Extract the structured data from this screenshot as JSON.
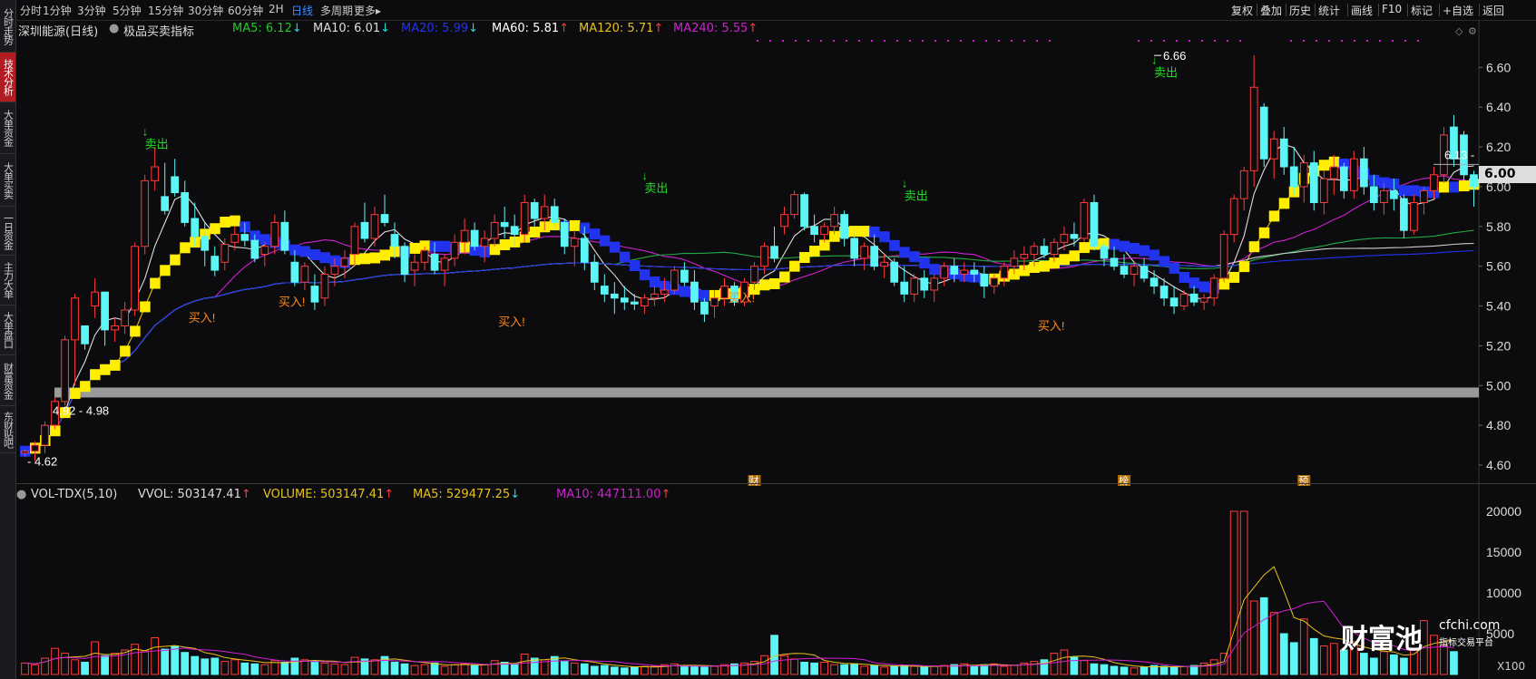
{
  "sidebar": {
    "items": [
      {
        "label": "分时走势",
        "active": false
      },
      {
        "label": "技术分析",
        "active": true
      },
      {
        "label": "大单资金",
        "active": false
      },
      {
        "label": "大单买卖",
        "active": false
      },
      {
        "label": "一日资金",
        "active": false
      },
      {
        "label": "主力大单",
        "active": false
      },
      {
        "label": "大单盘口",
        "active": false
      },
      {
        "label": "财富资金",
        "active": false
      },
      {
        "label": "东财贴吧",
        "active": false
      }
    ]
  },
  "toolbar": {
    "timeframes": [
      "分时",
      "1分钟",
      "3分钟",
      "5分钟",
      "15分钟",
      "30分钟",
      "60分钟",
      "2H",
      "日线",
      "多周期",
      "更多"
    ],
    "active_timeframe": "日线",
    "more_arrow": "▸",
    "right_buttons": [
      "复权",
      "叠加",
      "历史",
      "统计",
      "画线",
      "F10",
      "标记",
      "+自选",
      "返回"
    ]
  },
  "chart_header": {
    "title": "深圳能源(日线)",
    "indicator": "极品买卖指标",
    "ma": [
      {
        "label": "MA5: 6.12",
        "arrow": "↓",
        "color": "#22cc22"
      },
      {
        "label": "MA10: 6.01",
        "arrow": "↓",
        "color": "#dddddd"
      },
      {
        "label": "MA20: 5.99",
        "arrow": "↓",
        "color": "#2233ee"
      },
      {
        "label": "MA60: 5.81",
        "arrow": "↑",
        "color": "#ffffff"
      },
      {
        "label": "MA120: 5.71",
        "arrow": "↑",
        "color": "#e8c21b"
      },
      {
        "label": "MA240: 5.55",
        "arrow": "↑",
        "color": "#d020d0"
      }
    ],
    "arrow_up_color": "#ff3b3b",
    "arrow_down_color": "#22dddd"
  },
  "volume_header": {
    "name": "VOL-TDX(5,10)",
    "items": [
      {
        "label": "VVOL: 503147.41",
        "arrow": "↑",
        "color": "#dddddd"
      },
      {
        "label": "VOLUME: 503147.41",
        "arrow": "↑",
        "color": "#e8c21b"
      },
      {
        "label": "MA5: 529477.25",
        "arrow": "↓",
        "color": "#e8c21b"
      },
      {
        "label": "MA10: 447111.00",
        "arrow": "↑",
        "color": "#d020d0"
      }
    ]
  },
  "chart_data": [
    {
      "type": "candlestick",
      "name": "price",
      "ylim": [
        4.55,
        6.72
      ],
      "y_ticks": [
        "6.60",
        "6.40",
        "6.20",
        "6.00",
        "5.80",
        "5.60",
        "5.40",
        "5.20",
        "5.00",
        "4.80",
        "4.60"
      ],
      "current_price": "6.00",
      "ohlc": [
        [
          4.66,
          4.68,
          4.64,
          4.67
        ],
        [
          4.67,
          4.72,
          4.62,
          4.7
        ],
        [
          4.7,
          4.82,
          4.66,
          4.8
        ],
        [
          4.8,
          4.94,
          4.78,
          4.92
        ],
        [
          4.92,
          5.25,
          4.9,
          5.23
        ],
        [
          5.23,
          5.46,
          5.0,
          5.44
        ],
        [
          5.3,
          5.3,
          5.18,
          5.21
        ],
        [
          5.4,
          5.54,
          5.34,
          5.47
        ],
        [
          5.47,
          5.4,
          5.2,
          5.28
        ],
        [
          5.28,
          5.34,
          5.22,
          5.3
        ],
        [
          5.3,
          5.42,
          5.26,
          5.38
        ],
        [
          5.38,
          5.72,
          5.35,
          5.7
        ],
        [
          5.7,
          6.06,
          5.66,
          6.03
        ],
        [
          6.03,
          6.2,
          5.98,
          6.1
        ],
        [
          5.95,
          6.12,
          5.86,
          5.88
        ],
        [
          6.05,
          6.14,
          5.95,
          5.97
        ],
        [
          5.97,
          6.03,
          5.8,
          5.82
        ],
        [
          5.84,
          5.92,
          5.7,
          5.75
        ],
        [
          5.75,
          5.82,
          5.6,
          5.68
        ],
        [
          5.65,
          5.7,
          5.55,
          5.58
        ],
        [
          5.62,
          5.74,
          5.58,
          5.71
        ],
        [
          5.72,
          5.8,
          5.68,
          5.76
        ],
        [
          5.76,
          5.82,
          5.7,
          5.73
        ],
        [
          5.73,
          5.76,
          5.62,
          5.64
        ],
        [
          5.66,
          5.72,
          5.6,
          5.7
        ],
        [
          5.7,
          5.86,
          5.66,
          5.82
        ],
        [
          5.82,
          5.88,
          5.66,
          5.68
        ],
        [
          5.62,
          5.68,
          5.5,
          5.52
        ],
        [
          5.52,
          5.62,
          5.48,
          5.6
        ],
        [
          5.5,
          5.56,
          5.38,
          5.42
        ],
        [
          5.44,
          5.6,
          5.4,
          5.56
        ],
        [
          5.56,
          5.64,
          5.5,
          5.6
        ],
        [
          5.6,
          5.68,
          5.54,
          5.64
        ],
        [
          5.66,
          5.82,
          5.6,
          5.8
        ],
        [
          5.82,
          5.92,
          5.72,
          5.74
        ],
        [
          5.74,
          5.9,
          5.7,
          5.86
        ],
        [
          5.86,
          5.96,
          5.8,
          5.82
        ],
        [
          5.76,
          5.82,
          5.64,
          5.7
        ],
        [
          5.7,
          5.72,
          5.52,
          5.56
        ],
        [
          5.58,
          5.66,
          5.5,
          5.62
        ],
        [
          5.62,
          5.7,
          5.58,
          5.68
        ],
        [
          5.66,
          5.72,
          5.56,
          5.58
        ],
        [
          5.58,
          5.66,
          5.5,
          5.64
        ],
        [
          5.64,
          5.76,
          5.6,
          5.72
        ],
        [
          5.72,
          5.84,
          5.66,
          5.78
        ],
        [
          5.78,
          5.82,
          5.68,
          5.7
        ],
        [
          5.7,
          5.78,
          5.62,
          5.74
        ],
        [
          5.74,
          5.86,
          5.7,
          5.82
        ],
        [
          5.82,
          5.9,
          5.74,
          5.8
        ],
        [
          5.8,
          5.86,
          5.7,
          5.76
        ],
        [
          5.76,
          5.96,
          5.72,
          5.92
        ],
        [
          5.92,
          5.94,
          5.8,
          5.84
        ],
        [
          5.84,
          5.96,
          5.78,
          5.9
        ],
        [
          5.9,
          5.94,
          5.78,
          5.82
        ],
        [
          5.82,
          5.84,
          5.66,
          5.7
        ],
        [
          5.7,
          5.78,
          5.6,
          5.74
        ],
        [
          5.74,
          5.8,
          5.58,
          5.62
        ],
        [
          5.62,
          5.66,
          5.48,
          5.52
        ],
        [
          5.5,
          5.56,
          5.42,
          5.46
        ],
        [
          5.46,
          5.52,
          5.36,
          5.44
        ],
        [
          5.44,
          5.5,
          5.38,
          5.42
        ],
        [
          5.42,
          5.46,
          5.38,
          5.41
        ],
        [
          5.4,
          5.46,
          5.36,
          5.44
        ],
        [
          5.44,
          5.5,
          5.4,
          5.46
        ],
        [
          5.46,
          5.54,
          5.42,
          5.48
        ],
        [
          5.48,
          5.6,
          5.46,
          5.58
        ],
        [
          5.58,
          5.62,
          5.5,
          5.52
        ],
        [
          5.52,
          5.58,
          5.38,
          5.42
        ],
        [
          5.42,
          5.44,
          5.32,
          5.36
        ],
        [
          5.4,
          5.48,
          5.34,
          5.44
        ],
        [
          5.44,
          5.54,
          5.4,
          5.5
        ],
        [
          5.5,
          5.52,
          5.4,
          5.42
        ],
        [
          5.42,
          5.54,
          5.4,
          5.52
        ],
        [
          5.52,
          5.62,
          5.48,
          5.6
        ],
        [
          5.6,
          5.72,
          5.56,
          5.7
        ],
        [
          5.7,
          5.8,
          5.62,
          5.64
        ],
        [
          5.8,
          5.9,
          5.76,
          5.86
        ],
        [
          5.86,
          5.98,
          5.84,
          5.96
        ],
        [
          5.96,
          5.97,
          5.78,
          5.8
        ],
        [
          5.8,
          5.86,
          5.72,
          5.76
        ],
        [
          5.76,
          5.82,
          5.72,
          5.8
        ],
        [
          5.8,
          5.9,
          5.76,
          5.86
        ],
        [
          5.86,
          5.88,
          5.7,
          5.74
        ],
        [
          5.74,
          5.78,
          5.6,
          5.64
        ],
        [
          5.64,
          5.72,
          5.58,
          5.7
        ],
        [
          5.7,
          5.76,
          5.58,
          5.6
        ],
        [
          5.6,
          5.66,
          5.54,
          5.62
        ],
        [
          5.62,
          5.64,
          5.5,
          5.52
        ],
        [
          5.52,
          5.6,
          5.42,
          5.46
        ],
        [
          5.46,
          5.56,
          5.42,
          5.54
        ],
        [
          5.54,
          5.58,
          5.44,
          5.48
        ],
        [
          5.48,
          5.56,
          5.42,
          5.54
        ],
        [
          5.54,
          5.62,
          5.5,
          5.6
        ],
        [
          5.6,
          5.64,
          5.52,
          5.56
        ],
        [
          5.56,
          5.62,
          5.52,
          5.58
        ],
        [
          5.58,
          5.62,
          5.52,
          5.56
        ],
        [
          5.56,
          5.6,
          5.44,
          5.5
        ],
        [
          5.5,
          5.56,
          5.46,
          5.54
        ],
        [
          5.54,
          5.62,
          5.5,
          5.6
        ],
        [
          5.6,
          5.68,
          5.56,
          5.64
        ],
        [
          5.64,
          5.7,
          5.58,
          5.66
        ],
        [
          5.66,
          5.72,
          5.6,
          5.7
        ],
        [
          5.7,
          5.74,
          5.64,
          5.66
        ],
        [
          5.66,
          5.74,
          5.62,
          5.72
        ],
        [
          5.72,
          5.8,
          5.68,
          5.76
        ],
        [
          5.76,
          5.82,
          5.7,
          5.74
        ],
        [
          5.74,
          5.94,
          5.72,
          5.92
        ],
        [
          5.92,
          5.96,
          5.68,
          5.7
        ],
        [
          5.7,
          5.72,
          5.6,
          5.64
        ],
        [
          5.64,
          5.7,
          5.58,
          5.6
        ],
        [
          5.6,
          5.66,
          5.54,
          5.56
        ],
        [
          5.56,
          5.62,
          5.5,
          5.6
        ],
        [
          5.6,
          5.64,
          5.52,
          5.54
        ],
        [
          5.54,
          5.58,
          5.46,
          5.5
        ],
        [
          5.5,
          5.54,
          5.4,
          5.44
        ],
        [
          5.44,
          5.5,
          5.36,
          5.4
        ],
        [
          5.4,
          5.48,
          5.38,
          5.46
        ],
        [
          5.46,
          5.5,
          5.4,
          5.42
        ],
        [
          5.42,
          5.46,
          5.38,
          5.44
        ],
        [
          5.44,
          5.56,
          5.4,
          5.54
        ],
        [
          5.54,
          5.78,
          5.52,
          5.76
        ],
        [
          5.76,
          5.96,
          5.72,
          5.94
        ],
        [
          5.94,
          6.1,
          5.88,
          6.08
        ],
        [
          6.08,
          6.66,
          6.0,
          6.5
        ],
        [
          6.4,
          6.42,
          6.1,
          6.14
        ],
        [
          6.14,
          6.28,
          6.04,
          6.24
        ],
        [
          6.24,
          6.3,
          6.06,
          6.1
        ],
        [
          6.1,
          6.2,
          5.96,
          6.0
        ],
        [
          6.0,
          6.16,
          5.92,
          6.12
        ],
        [
          6.12,
          6.18,
          5.88,
          5.92
        ],
        [
          5.92,
          6.08,
          5.86,
          6.04
        ],
        [
          6.04,
          6.16,
          5.96,
          6.1
        ],
        [
          6.1,
          6.12,
          5.94,
          5.98
        ],
        [
          5.98,
          6.18,
          5.94,
          6.14
        ],
        [
          6.14,
          6.2,
          5.96,
          6.0
        ],
        [
          6.0,
          6.06,
          5.88,
          5.92
        ],
        [
          5.92,
          6.02,
          5.86,
          5.98
        ],
        [
          5.98,
          6.04,
          5.88,
          5.94
        ],
        [
          5.94,
          5.96,
          5.74,
          5.78
        ],
        [
          5.78,
          5.96,
          5.76,
          5.92
        ],
        [
          5.92,
          6.0,
          5.86,
          5.98
        ],
        [
          5.98,
          6.1,
          5.94,
          6.06
        ],
        [
          6.06,
          6.3,
          6.02,
          6.26
        ],
        [
          6.3,
          6.36,
          6.1,
          6.14
        ],
        [
          6.26,
          6.28,
          6.02,
          6.06
        ],
        [
          6.06,
          6.08,
          5.9,
          6.0
        ]
      ],
      "ma_series": [
        {
          "name": "MA5",
          "color": "#dddddd"
        },
        {
          "name": "MA10",
          "color": "#e8c21b"
        },
        {
          "name": "MA20",
          "color": "#d020d0"
        },
        {
          "name": "MA60",
          "color": "#22aa44"
        },
        {
          "name": "MA120",
          "color": "#cccccc"
        },
        {
          "name": "MA240",
          "color": "#2233ee"
        }
      ],
      "signals": [
        {
          "index": 12,
          "text": "卖出",
          "arrow": "↓",
          "kind": "sell",
          "price": 6.22
        },
        {
          "index": 18,
          "text": "买入!",
          "kind": "buy",
          "price": 5.32
        },
        {
          "index": 27,
          "text": "买入!",
          "kind": "buy",
          "price": 5.4
        },
        {
          "index": 49,
          "text": "买入!",
          "kind": "buy",
          "price": 5.3
        },
        {
          "index": 62,
          "text": "卖出",
          "arrow": "↓",
          "kind": "sell",
          "price": 6.0
        },
        {
          "index": 72,
          "text": "买入!",
          "kind": "buy",
          "price": 5.42
        },
        {
          "index": 88,
          "text": "卖出",
          "arrow": "↓",
          "kind": "sell",
          "price": 5.96
        },
        {
          "index": 103,
          "text": "买入!",
          "kind": "buy",
          "price": 5.28
        },
        {
          "index": 113,
          "text": "卖出",
          "arrow": "↓",
          "kind": "sell",
          "price": 6.58
        }
      ],
      "annotations": [
        {
          "text": "4.62",
          "price": 4.62
        },
        {
          "text": "4.92 - 4.98",
          "price": 4.98
        },
        {
          "text": "6.66",
          "price": 6.66
        },
        {
          "text": "6.13 -",
          "price": 6.13
        }
      ],
      "support_band": [
        4.94,
        4.99
      ],
      "event_marks": [
        {
          "text": "财",
          "index": 73
        },
        {
          "text": "榜",
          "index": 110
        },
        {
          "text": "预",
          "index": 128
        }
      ]
    },
    {
      "type": "bar",
      "name": "volume",
      "ylim": [
        0,
        21000
      ],
      "y_ticks": [
        "20000",
        "15000",
        "10000",
        "5000"
      ],
      "unit": "X100",
      "values": [
        1400,
        1200,
        2000,
        3200,
        2600,
        1800,
        1500,
        4000,
        2300,
        2600,
        3000,
        3700,
        2900,
        4500,
        3100,
        3500,
        2700,
        2200,
        1900,
        2000,
        1600,
        1800,
        1400,
        1300,
        1200,
        1700,
        1500,
        2000,
        1800,
        1600,
        1400,
        1300,
        1200,
        2100,
        1900,
        1800,
        2200,
        1500,
        1300,
        1100,
        1200,
        1400,
        1000,
        1200,
        1300,
        1100,
        1200,
        1700,
        1500,
        1200,
        2500,
        2000,
        1800,
        2200,
        1600,
        1400,
        1300,
        1000,
        1100,
        900,
        800,
        900,
        1000,
        1000,
        1200,
        1300,
        1100,
        1000,
        900,
        1000,
        1200,
        1300,
        1400,
        1600,
        2300,
        4800,
        2300,
        1900,
        1500,
        1400,
        1500,
        1200,
        1200,
        1300,
        1000,
        1100,
        900,
        1000,
        1100,
        1000,
        900,
        1000,
        1100,
        1200,
        1300,
        1100,
        1200,
        1300,
        1000,
        1100,
        1400,
        1600,
        1800,
        2600,
        3000,
        2100,
        1700,
        1300,
        1200,
        1000,
        900,
        800,
        900,
        1100,
        1000,
        900,
        1000,
        1100,
        1400,
        1800,
        2600,
        20000,
        20000,
        9000,
        9400,
        7600,
        5000,
        3900,
        6800,
        4400,
        3500,
        3800,
        3000,
        4000,
        2600,
        2000,
        2800,
        2400,
        2000,
        3200,
        6600,
        4800,
        3600,
        2800
      ],
      "colors": {
        "up": "#ff3b3b",
        "down": "#5cf6f6",
        "ma5": "#e8c21b",
        "ma10": "#d020d0"
      }
    }
  ],
  "watermark": {
    "brand": "财富池",
    "site": "cfchi.com",
    "tagline": "指标交易平台"
  }
}
